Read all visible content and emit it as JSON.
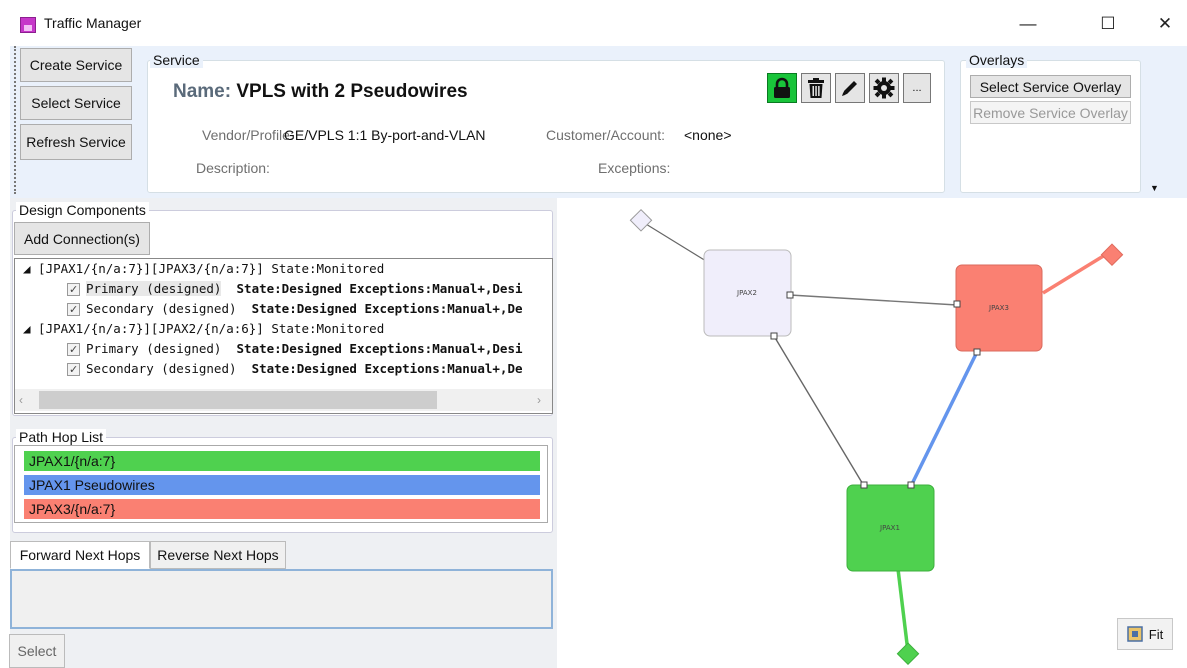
{
  "window": {
    "title": "Traffic Manager",
    "minimize": "—",
    "maximize": "☐",
    "close": "✕",
    "colors": {
      "app_icon": "#c637c9"
    }
  },
  "toolbar": {
    "create_label": "Create Service",
    "select_label": "Select Service",
    "refresh_label": "Refresh Service"
  },
  "service": {
    "group_label": "Service",
    "name_key": "Name:",
    "name_value": "VPLS with 2 Pseudowires",
    "vendor_label": "Vendor/Profile:",
    "vendor_value": "GE/VPLS 1:1 By-port-and-VLAN",
    "customer_label": "Customer/Account:",
    "customer_value": "<none>",
    "description_label": "Description:",
    "exceptions_label": "Exceptions:",
    "icons": [
      "lock-icon",
      "trash-icon",
      "pencil-icon",
      "gear-icon",
      "more-icon"
    ],
    "more_label": "..."
  },
  "overlays": {
    "group_label": "Overlays",
    "select_label": "Select Service Overlay",
    "remove_label": "Remove Service Overlay"
  },
  "design": {
    "group_label": "Design Components",
    "add_label": "Add Connection(s)",
    "rows": [
      {
        "text": "◢ [JPAX1/{n/a:7}][JPAX3/{n/a:7}] State:Monitored"
      },
      {
        "name": "Primary (designed)",
        "state": "State:Designed Exceptions:Manual+,Desi"
      },
      {
        "name": "Secondary (designed)",
        "state": "State:Designed Exceptions:Manual+,De"
      },
      {
        "text": "◢ [JPAX1/{n/a:7}][JPAX2/{n/a:6}] State:Monitored"
      },
      {
        "name": "Primary (designed)",
        "state": "State:Designed Exceptions:Manual+,Desi"
      },
      {
        "name": "Secondary (designed)",
        "state": "State:Designed Exceptions:Manual+,De"
      }
    ]
  },
  "path_hops": {
    "group_label": "Path Hop List",
    "items": [
      {
        "label": "JPAX1/{n/a:7}",
        "color": "#4fd14f"
      },
      {
        "label": "JPAX1 Pseudowires",
        "color": "#6495ed"
      },
      {
        "label": "JPAX3/{n/a:7}",
        "color": "#fa8072"
      }
    ]
  },
  "next_hops": {
    "tab_forward": "Forward Next Hops",
    "tab_reverse": "Reverse Next Hops",
    "select_label": "Select"
  },
  "topology": {
    "nodes": [
      {
        "label": "JPAX2",
        "color": "#f0eefb"
      },
      {
        "label": "JPAX3",
        "color": "#fa8072"
      },
      {
        "label": "JPAX1",
        "color": "#4fd14f"
      }
    ],
    "fit_label": "Fit"
  }
}
